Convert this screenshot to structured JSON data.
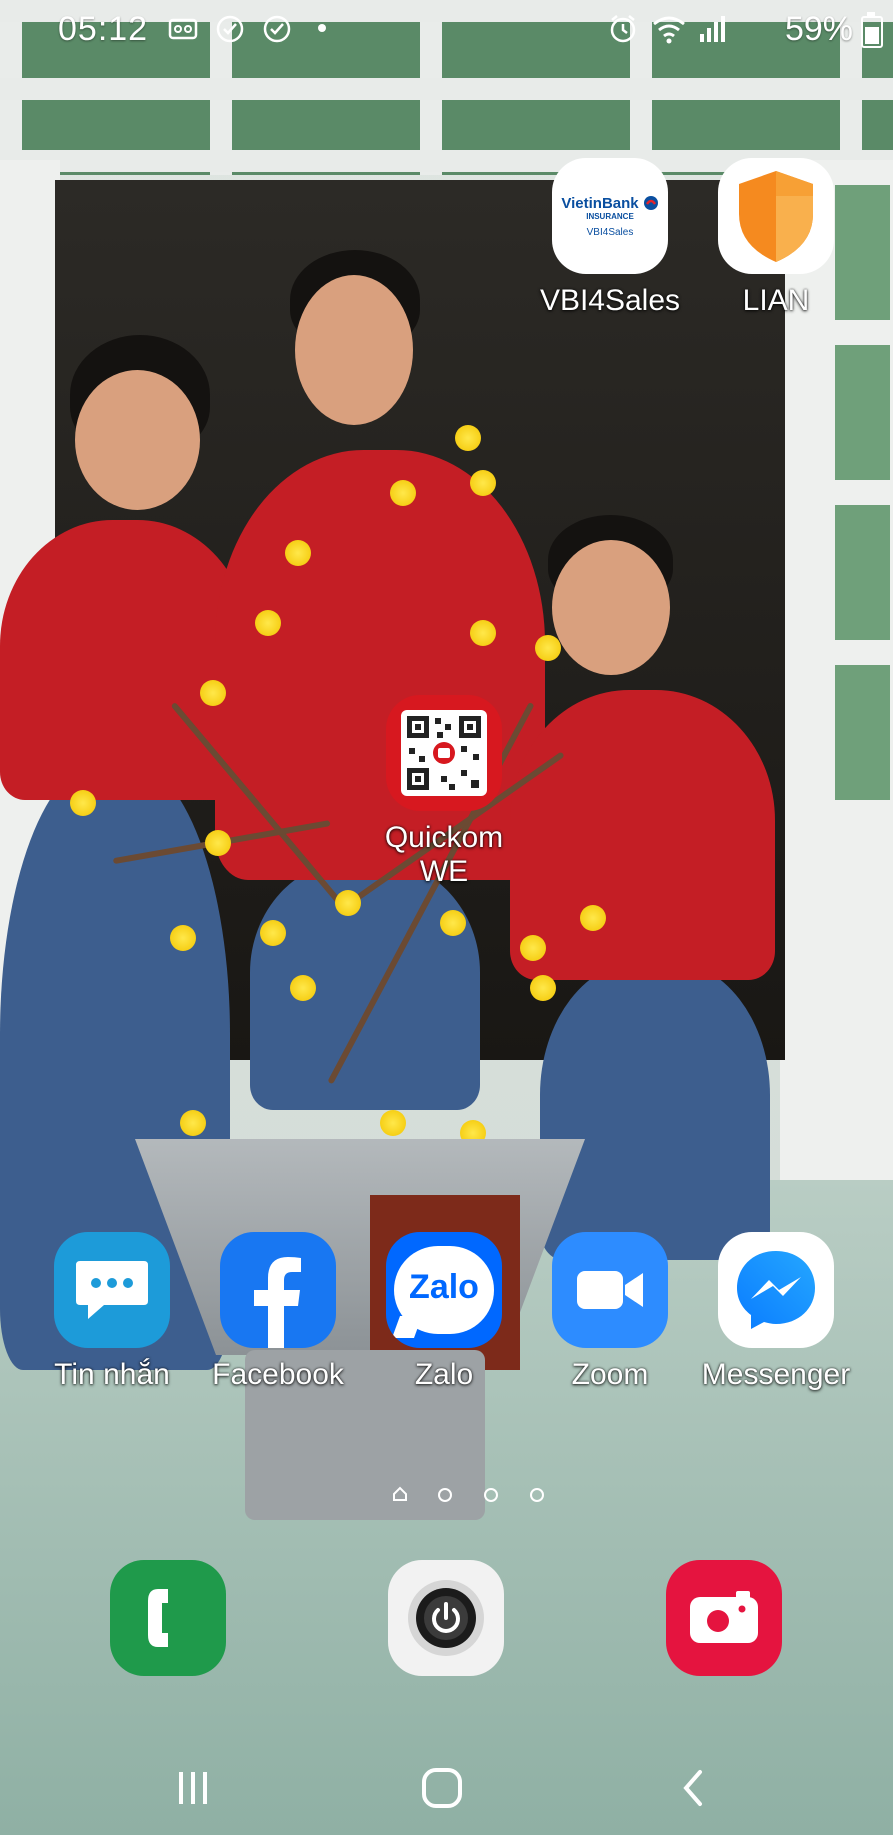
{
  "status_bar": {
    "time": "05:12",
    "battery": "59%",
    "battery_level": 0.59,
    "icons": [
      "voicemail-icon",
      "sync-icon",
      "sync-icon",
      "dot-icon",
      "alarm-icon",
      "wifi-icon",
      "signal-icon",
      "battery-icon"
    ]
  },
  "top_apps": [
    {
      "label": "VBI4Sales",
      "icon": "vietinbank-insurance-icon",
      "brand_text": "VietinBank",
      "sub_text": "INSURANCE",
      "tag": "VBI4Sales"
    },
    {
      "label": "LIAN",
      "icon": "shield-icon"
    }
  ],
  "middle_app": {
    "label_line1": "Quickom",
    "label_line2": "WE",
    "icon": "qr-code-icon"
  },
  "row_apps": [
    {
      "label": "Tin nhắn",
      "icon": "messages-icon"
    },
    {
      "label": "Facebook",
      "icon": "facebook-icon"
    },
    {
      "label": "Zalo",
      "icon": "zalo-icon",
      "logo_text": "Zalo"
    },
    {
      "label": "Zoom",
      "icon": "zoom-icon"
    },
    {
      "label": "Messenger",
      "icon": "messenger-icon"
    }
  ],
  "page_indicator": {
    "pages": 3,
    "current": 1
  },
  "dock": [
    {
      "icon": "phone-icon"
    },
    {
      "icon": "power-icon"
    },
    {
      "icon": "camera-icon"
    }
  ],
  "colors": {
    "zalo_blue": "#0068ff",
    "facebook_blue": "#1877f2",
    "messages_blue": "#1d9bd9",
    "zoom_blue": "#2d8cff",
    "phone_green": "#1f9a4b",
    "camera_red": "#e5143f",
    "lian_orange": "#f58a1f"
  }
}
